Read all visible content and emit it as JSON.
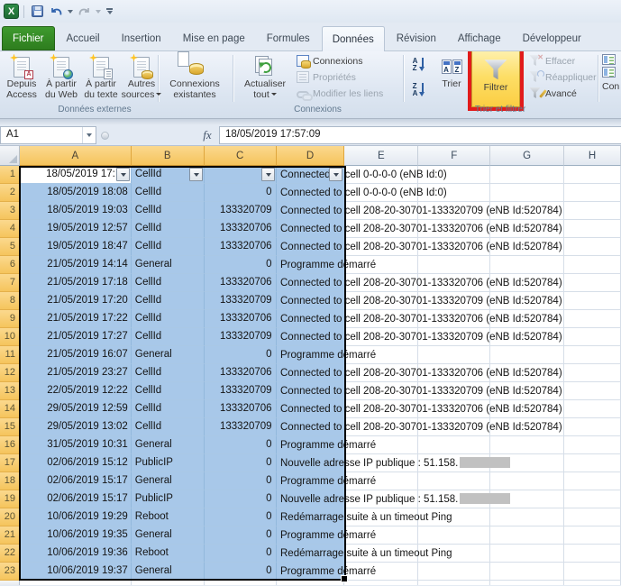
{
  "window": {
    "qat_tooltips": [
      "Enregistrer",
      "Annuler",
      "Rétablir"
    ]
  },
  "colors": {
    "selection_fill": "#A8C8E9",
    "selected_header": "#F5C45C",
    "highlight_box": "#E11B1B",
    "filter_button_bg": "#FDDE66",
    "file_tab_green": "#3E9A2E"
  },
  "ribbon": {
    "tabs": [
      {
        "label": "Fichier",
        "type": "file"
      },
      {
        "label": "Accueil"
      },
      {
        "label": "Insertion"
      },
      {
        "label": "Mise en page"
      },
      {
        "label": "Formules"
      },
      {
        "label": "Données",
        "active": true
      },
      {
        "label": "Révision"
      },
      {
        "label": "Affichage"
      },
      {
        "label": "Développeur"
      }
    ],
    "external_group": {
      "label": "Données externes",
      "buttons": [
        {
          "label1": "Depuis",
          "label2": "Access",
          "icon": "access"
        },
        {
          "label1": "À partir",
          "label2": "du Web",
          "icon": "web"
        },
        {
          "label1": "À partir",
          "label2": "du texte",
          "icon": "text"
        },
        {
          "label1": "Autres",
          "label2": "sources",
          "icon": "sources",
          "dropdown": true
        },
        {
          "label1": "Connexions",
          "label2": "existantes",
          "icon": "existing"
        }
      ]
    },
    "connections_group": {
      "label": "Connexions",
      "big_button": {
        "label1": "Actualiser",
        "label2": "tout",
        "dropdown": true
      },
      "small_buttons": [
        {
          "label": "Connexions",
          "icon": "connections",
          "enabled": true
        },
        {
          "label": "Propriétés",
          "icon": "properties",
          "enabled": false
        },
        {
          "label": "Modifier les liens",
          "icon": "edit-links",
          "enabled": false
        }
      ]
    },
    "sort_group": {
      "label": "Trier et filtrer",
      "trier_label": "Trier",
      "filtrer_label": "Filtrer",
      "small_buttons": [
        {
          "label": "Effacer",
          "icon": "clear-filter",
          "enabled": false
        },
        {
          "label": "Réappliquer",
          "icon": "reapply",
          "enabled": false
        },
        {
          "label": "Avancé",
          "icon": "advanced",
          "enabled": true
        }
      ]
    },
    "partial_group": {
      "label": "Con"
    }
  },
  "formula_bar": {
    "cell_ref": "A1",
    "fx_label": "fx",
    "value": "18/05/2019 17:57:09"
  },
  "sheet": {
    "visible_columns": [
      "A",
      "B",
      "C",
      "D",
      "E",
      "F",
      "G",
      "H"
    ],
    "selected_columns": [
      "A",
      "B",
      "C",
      "D"
    ],
    "selection_range": "A1:D23",
    "rows": [
      {
        "n": 1,
        "a": "18/05/2019 17:",
        "b": "CellId",
        "c": "",
        "d": "Connected to cell 0-0-0-0 (eNB Id:0)",
        "active_cell": true,
        "filter_buttons": true
      },
      {
        "n": 2,
        "a": "18/05/2019 18:08",
        "b": "CellId",
        "c": "0",
        "d": "Connected to cell 0-0-0-0 (eNB Id:0)"
      },
      {
        "n": 3,
        "a": "18/05/2019 19:03",
        "b": "CellId",
        "c": "133320709",
        "d": "Connected to cell 208-20-30701-133320709 (eNB Id:520784)"
      },
      {
        "n": 4,
        "a": "19/05/2019 12:57",
        "b": "CellId",
        "c": "133320706",
        "d": "Connected to cell 208-20-30701-133320706 (eNB Id:520784)"
      },
      {
        "n": 5,
        "a": "19/05/2019 18:47",
        "b": "CellId",
        "c": "133320706",
        "d": "Connected to cell 208-20-30701-133320706 (eNB Id:520784)"
      },
      {
        "n": 6,
        "a": "21/05/2019 14:14",
        "b": "General",
        "c": "0",
        "d": "Programme démarré"
      },
      {
        "n": 7,
        "a": "21/05/2019 17:18",
        "b": "CellId",
        "c": "133320706",
        "d": "Connected to cell 208-20-30701-133320706 (eNB Id:520784)"
      },
      {
        "n": 8,
        "a": "21/05/2019 17:20",
        "b": "CellId",
        "c": "133320709",
        "d": "Connected to cell 208-20-30701-133320709 (eNB Id:520784)"
      },
      {
        "n": 9,
        "a": "21/05/2019 17:22",
        "b": "CellId",
        "c": "133320706",
        "d": "Connected to cell 208-20-30701-133320706 (eNB Id:520784)"
      },
      {
        "n": 10,
        "a": "21/05/2019 17:27",
        "b": "CellId",
        "c": "133320709",
        "d": "Connected to cell 208-20-30701-133320709 (eNB Id:520784)"
      },
      {
        "n": 11,
        "a": "21/05/2019 16:07",
        "b": "General",
        "c": "0",
        "d": "Programme démarré"
      },
      {
        "n": 12,
        "a": "21/05/2019 23:27",
        "b": "CellId",
        "c": "133320706",
        "d": "Connected to cell 208-20-30701-133320706 (eNB Id:520784)"
      },
      {
        "n": 13,
        "a": "22/05/2019 12:22",
        "b": "CellId",
        "c": "133320709",
        "d": "Connected to cell 208-20-30701-133320709 (eNB Id:520784)"
      },
      {
        "n": 14,
        "a": "29/05/2019 12:59",
        "b": "CellId",
        "c": "133320706",
        "d": "Connected to cell 208-20-30701-133320706 (eNB Id:520784)"
      },
      {
        "n": 15,
        "a": "29/05/2019 13:02",
        "b": "CellId",
        "c": "133320709",
        "d": "Connected to cell 208-20-30701-133320709 (eNB Id:520784)"
      },
      {
        "n": 16,
        "a": "31/05/2019 10:31",
        "b": "General",
        "c": "0",
        "d": "Programme démarré"
      },
      {
        "n": 17,
        "a": "02/06/2019 15:12",
        "b": "PublicIP",
        "c": "0",
        "d": "Nouvelle adresse IP publique : 51.158.",
        "redacted": true
      },
      {
        "n": 18,
        "a": "02/06/2019 15:17",
        "b": "General",
        "c": "0",
        "d": "Programme démarré"
      },
      {
        "n": 19,
        "a": "02/06/2019 15:17",
        "b": "PublicIP",
        "c": "0",
        "d": "Nouvelle adresse IP publique : 51.158.",
        "redacted": true
      },
      {
        "n": 20,
        "a": "10/06/2019 19:29",
        "b": "Reboot",
        "c": "0",
        "d": "Redémarrage suite à un timeout Ping"
      },
      {
        "n": 21,
        "a": "10/06/2019 19:35",
        "b": "General",
        "c": "0",
        "d": "Programme démarré"
      },
      {
        "n": 22,
        "a": "10/06/2019 19:36",
        "b": "Reboot",
        "c": "0",
        "d": "Redémarrage suite à un timeout Ping"
      },
      {
        "n": 23,
        "a": "10/06/2019 19:37",
        "b": "General",
        "c": "0",
        "d": "Programme démarré"
      }
    ]
  }
}
